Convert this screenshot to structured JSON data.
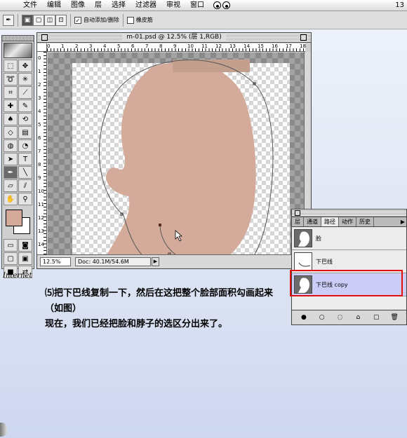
{
  "menubar": {
    "items": [
      "文件",
      "编辑",
      "图像",
      "层",
      "选择",
      "过滤器",
      "审视",
      "窗口"
    ],
    "right_text": "13"
  },
  "options": {
    "auto_add_delete": "自动添加/删除",
    "rubber_band": "橡皮筋"
  },
  "document": {
    "title": "m-01.psd @ 12.5% (层 1,RGB)",
    "zoom": "12.5%",
    "doc_size": "Doc: 40.1M/54.6M",
    "ruler_top": [
      "0",
      "1",
      "2",
      "3",
      "4",
      "5",
      "6",
      "7",
      "8",
      "9",
      "10",
      "11",
      "12",
      "13",
      "14",
      "15",
      "16",
      "17",
      "18"
    ],
    "ruler_left": [
      "0",
      "1",
      "2",
      "3",
      "4",
      "5",
      "6",
      "7",
      "8",
      "9",
      "10",
      "11",
      "12",
      "13",
      "14"
    ]
  },
  "colors": {
    "skin": "#d4ab9a",
    "foreground": "#d4ab9a",
    "highlight": "#e01010",
    "selected_path": "#ccccf8"
  },
  "toolbox": {
    "label_below": "Internet"
  },
  "paths_palette": {
    "tabs": [
      "层",
      "通道",
      "路径",
      "动作",
      "历史"
    ],
    "active_tab": "路径",
    "paths": [
      {
        "name": "脸",
        "icon": "face-silhouette-icon"
      },
      {
        "name": "下巴线",
        "icon": "jaw-line-icon"
      },
      {
        "name": "下巴线 copy",
        "icon": "face-silhouette-icon"
      }
    ],
    "selected": "下巴线 copy"
  },
  "caption": {
    "line1": "⑸把下巴线复制一下，然后在这把整个脸部面积勾画起来（如图）",
    "line2": "现在，我们已经把脸和脖子的选区分出来了。"
  }
}
